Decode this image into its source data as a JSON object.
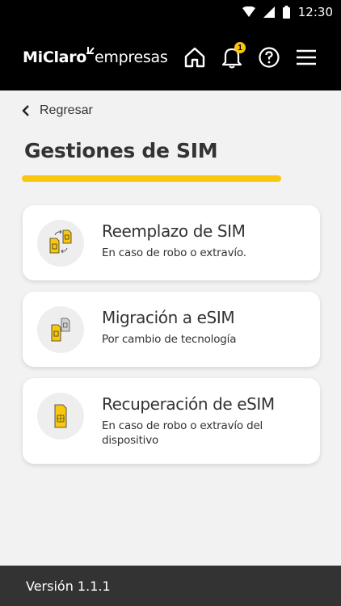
{
  "status_bar": {
    "time": "12:30"
  },
  "header": {
    "logo_part1": "MiClaro",
    "logo_part2": "empresas",
    "notification_count": "1"
  },
  "back_label": "Regresar",
  "page_title": "Gestiones de SIM",
  "colors": {
    "accent": "#f9c80e",
    "header_bg": "#000000",
    "footer_bg": "#333333"
  },
  "cards": [
    {
      "title": "Reemplazo de SIM",
      "subtitle": "En caso de robo o extravío.",
      "icon": "sim-swap-icon"
    },
    {
      "title": "Migración a eSIM",
      "subtitle": "Por cambio de tecnología",
      "icon": "sim-migration-icon"
    },
    {
      "title": "Recuperación de eSIM",
      "subtitle": "En caso de robo o extravío del dispositivo",
      "icon": "esim-icon"
    }
  ],
  "footer": {
    "version": "Versión 1.1.1"
  }
}
